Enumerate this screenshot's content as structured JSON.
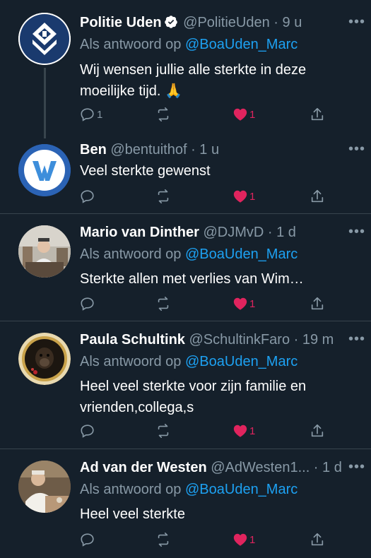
{
  "colors": {
    "background": "#15202b",
    "divider": "#38444d",
    "secondary_text": "#8899a6",
    "link": "#1da1f2",
    "like": "#e0245e"
  },
  "tweets": [
    {
      "name": "Politie Uden",
      "verified": true,
      "handle": "@PolitieUden",
      "time": "9 u",
      "reply_prefix": "Als antwoord op",
      "reply_mention": "@BoaUden_Marc",
      "text": "Wij wensen jullie alle sterkte in deze moeilijke tijd. 🙏",
      "replies": "1",
      "retweets": "",
      "likes": "1",
      "avatar": "police-logo"
    },
    {
      "name": "Ben",
      "verified": false,
      "handle": "@bentuithof",
      "time": "1 u",
      "reply_prefix": "",
      "reply_mention": "",
      "text": "Veel sterkte gewenst",
      "replies": "",
      "retweets": "",
      "likes": "1",
      "avatar": "w-logo"
    },
    {
      "name": "Mario van Dinther",
      "verified": false,
      "handle": "@DJMvD",
      "time": "1 d",
      "reply_prefix": "Als antwoord op",
      "reply_mention": "@BoaUden_Marc",
      "text": "Sterkte allen met verlies van Wim…",
      "replies": "",
      "retweets": "",
      "likes": "1",
      "avatar": "photo-man-studio"
    },
    {
      "name": "Paula Schultink",
      "verified": false,
      "handle": "@SchultinkFaro",
      "time": "19 m",
      "reply_prefix": "Als antwoord op",
      "reply_mention": "@BoaUden_Marc",
      "text": "Heel veel sterkte voor zijn familie en vrienden,collega,s",
      "replies": "",
      "retweets": "",
      "likes": "1",
      "avatar": "photo-dog-frame"
    },
    {
      "name": "Ad van der Westen",
      "verified": false,
      "handle": "@AdWesten1...",
      "time": "1 d",
      "reply_prefix": "Als antwoord op",
      "reply_mention": "@BoaUden_Marc",
      "text": "Heel veel sterkte",
      "replies": "",
      "retweets": "",
      "likes": "1",
      "avatar": "photo-man-table"
    }
  ]
}
